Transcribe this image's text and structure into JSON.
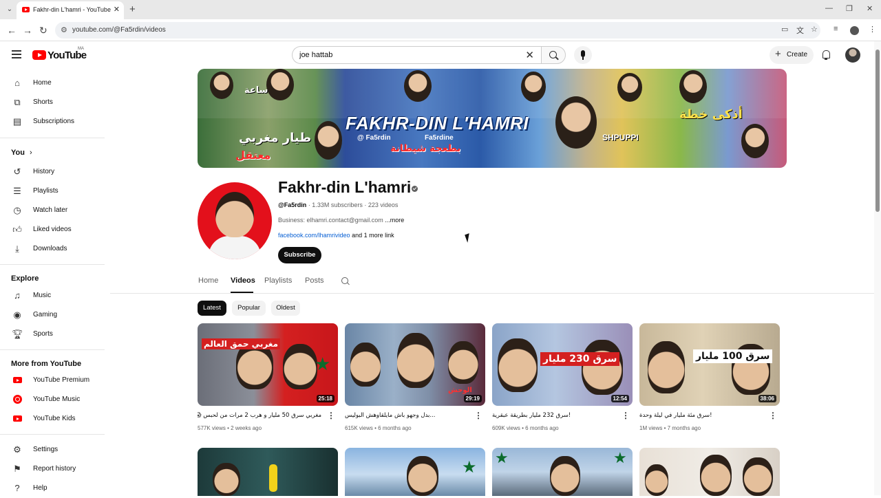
{
  "browser": {
    "tab_title": "Fakhr-din L'hamri - YouTube",
    "url": "youtube.com/@Fa5rdin/videos"
  },
  "header": {
    "logo_text": "YouTube",
    "country_code": "MA",
    "search_value": "joe hattab",
    "create_label": "Create"
  },
  "sidebar": {
    "main": [
      {
        "label": "Home",
        "icon": "home-icon"
      },
      {
        "label": "Shorts",
        "icon": "shorts-icon"
      },
      {
        "label": "Subscriptions",
        "icon": "subscriptions-icon"
      }
    ],
    "you_heading": "You",
    "you": [
      {
        "label": "History",
        "icon": "history-icon"
      },
      {
        "label": "Playlists",
        "icon": "playlists-icon"
      },
      {
        "label": "Watch later",
        "icon": "watch-later-icon"
      },
      {
        "label": "Liked videos",
        "icon": "liked-icon"
      },
      {
        "label": "Downloads",
        "icon": "download-icon"
      }
    ],
    "explore_heading": "Explore",
    "explore": [
      {
        "label": "Music",
        "icon": "music-icon"
      },
      {
        "label": "Gaming",
        "icon": "gaming-icon"
      },
      {
        "label": "Sports",
        "icon": "sports-icon"
      }
    ],
    "more_heading": "More from YouTube",
    "more": [
      {
        "label": "YouTube Premium",
        "icon": "youtube-premium-icon"
      },
      {
        "label": "YouTube Music",
        "icon": "youtube-music-icon"
      },
      {
        "label": "YouTube Kids",
        "icon": "youtube-kids-icon"
      }
    ],
    "bottom": [
      {
        "label": "Settings",
        "icon": "settings-icon"
      },
      {
        "label": "Report history",
        "icon": "flag-icon"
      },
      {
        "label": "Help",
        "icon": "help-icon"
      }
    ]
  },
  "banner": {
    "name": "FAKHR-DIN L'HAMRI",
    "handle1": "@ Fa5rdin",
    "handle2": "Fa5rdine",
    "arabic": [
      "طيار مغربي",
      "معتقل",
      "بطعجة شيطانة",
      "أذكى خطة",
      "ساعة"
    ],
    "shpuppi": "SHPUPPI"
  },
  "channel": {
    "name": "Fakhr-din L'hamri",
    "handle": "@Fa5rdin",
    "stats": "· 1.33M subscribers · 223 videos",
    "business": "Business: elhamri.contact@gmail.com",
    "more": "...more",
    "link": "facebook.com/lhamrivideo",
    "more_links": " and 1 more link",
    "subscribe": "Subscribe"
  },
  "tabs": [
    "Home",
    "Videos",
    "Playlists",
    "Posts"
  ],
  "active_tab": "Videos",
  "chips": [
    "Latest",
    "Popular",
    "Oldest"
  ],
  "videos": [
    {
      "title": "مغربي سرق 50 مليار و هرب 2 مرات من لحبس 😱",
      "meta": "577K views • 2 weeks ago",
      "duration": "25:18",
      "thumb_text": "مغربي حمق العالم"
    },
    {
      "title": "...بدل وجهو باش مايلقاوهش البوليس",
      "meta": "615K views • 6 months ago",
      "duration": "29:19",
      "thumb_text": "الوحش"
    },
    {
      "title": "!سرق 232 مليار بطريقة عبقرية",
      "meta": "609K views • 6 months ago",
      "duration": "12:54",
      "thumb_text": "سرق 230 مليار"
    },
    {
      "title": "!سرق مئة مليار في ليلة وحدة",
      "meta": "1M views • 7 months ago",
      "duration": "38:06",
      "thumb_text": "سرق 100 مليار"
    }
  ]
}
